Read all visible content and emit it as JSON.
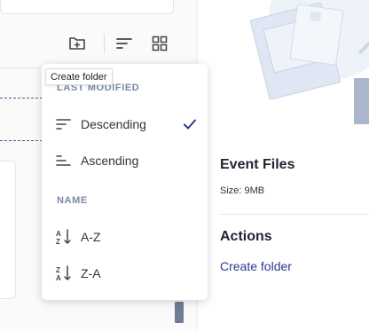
{
  "toolbar": {
    "create_folder_icon": "folder-plus-icon",
    "sort_icon": "sort-lines-icon",
    "grid_icon": "grid-view-icon"
  },
  "tooltip": {
    "text": "Create folder"
  },
  "sort_menu": {
    "sections": [
      {
        "heading": "LAST MODIFIED",
        "items": [
          {
            "label": "Descending",
            "icon": "sort-descending-icon",
            "selected": true
          },
          {
            "label": "Ascending",
            "icon": "sort-ascending-icon",
            "selected": false
          }
        ]
      },
      {
        "heading": "NAME",
        "items": [
          {
            "label": "A-Z",
            "icon": "sort-a-z-icon",
            "selected": false
          },
          {
            "label": "Z-A",
            "icon": "sort-z-a-icon",
            "selected": false
          }
        ]
      }
    ],
    "check_icon": "checkmark-icon"
  },
  "details": {
    "title": "Event Files",
    "size_text": "Size: 9MB",
    "actions_title": "Actions",
    "actions": [
      {
        "label": "Create folder"
      }
    ]
  },
  "colors": {
    "accent": "#2d3a8c",
    "muted_heading": "#7a8aa6",
    "illustration": "#dfe7f4"
  }
}
